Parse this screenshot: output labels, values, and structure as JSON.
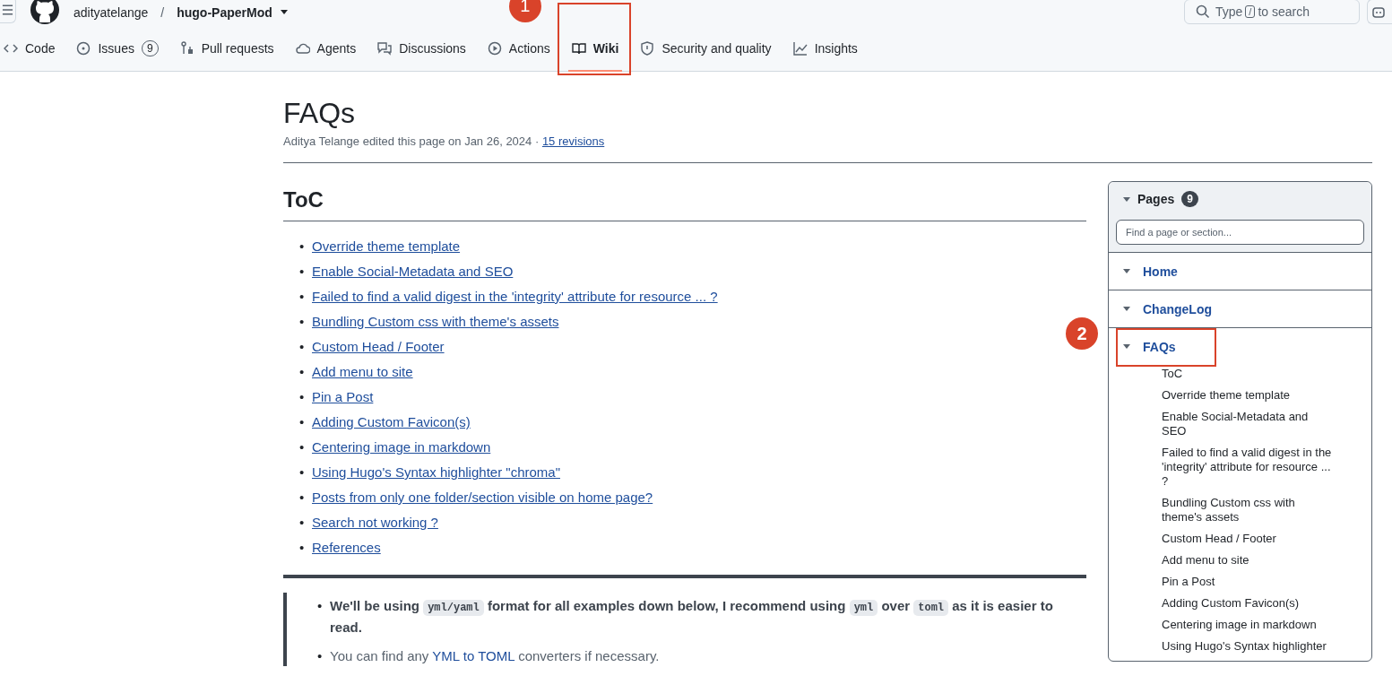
{
  "header": {
    "owner": "adityatelange",
    "separator": "/",
    "repo": "hugo-PaperMod",
    "search": {
      "placeholder_before": "Type",
      "key": "/",
      "placeholder_after": "to search"
    }
  },
  "tabs": [
    {
      "label": "Code",
      "selected": false,
      "kind": "code"
    },
    {
      "label": "Issues",
      "count": "9",
      "selected": false,
      "kind": "issues"
    },
    {
      "label": "Pull requests",
      "selected": false,
      "kind": "pulls"
    },
    {
      "label": "Agents",
      "selected": false,
      "kind": "agents"
    },
    {
      "label": "Discussions",
      "selected": false,
      "kind": "discussions"
    },
    {
      "label": "Actions",
      "selected": false,
      "kind": "actions"
    },
    {
      "label": "Wiki",
      "selected": true,
      "kind": "wiki",
      "annotation": "1"
    },
    {
      "label": "Security and quality",
      "selected": false,
      "kind": "security"
    },
    {
      "label": "Insights",
      "selected": false,
      "kind": "insights"
    }
  ],
  "page": {
    "title": "FAQs",
    "meta": "Aditya Telange edited this page on Jan 26, 2024 ·",
    "revisions": "15 revisions"
  },
  "toc": {
    "heading": "ToC",
    "bullet": "•",
    "items": [
      "Override theme template",
      "Enable Social-Metadata and SEO",
      "Failed to find a valid digest in the 'integrity' attribute for resource ... ?",
      "Bundling Custom css with theme's assets",
      "Custom Head / Footer",
      "Add menu to site",
      "Pin a Post",
      "Adding Custom Favicon(s)",
      "Centering image in markdown",
      "Using Hugo's Syntax highlighter \"chroma\"",
      "Posts from only one folder/section visible on home page?",
      "Search not working ?",
      "References"
    ]
  },
  "note_bullet": "•",
  "note": [
    {
      "bold": true,
      "segments": [
        {
          "kind": "text",
          "text": "We'll be using"
        },
        {
          "kind": "code",
          "text": "yml/yaml"
        },
        {
          "kind": "text",
          "text": "format for all examples down below, I recommend using"
        },
        {
          "kind": "code",
          "text": "yml"
        },
        {
          "kind": "text",
          "text": "over"
        },
        {
          "kind": "code",
          "text": "toml"
        },
        {
          "kind": "text",
          "text": "as it is easier to read."
        }
      ]
    },
    {
      "bold": false,
      "segments": [
        {
          "kind": "text",
          "text": "You can find any"
        },
        {
          "kind": "link",
          "text": "YML to TOML"
        },
        {
          "kind": "text",
          "text": "converters if necessary."
        }
      ]
    }
  ],
  "sidebar": {
    "title": "Pages",
    "count": "9",
    "search_placeholder": "Find a page or section...",
    "pages": [
      {
        "label": "Home",
        "expanded": true
      },
      {
        "label": "ChangeLog",
        "expanded": true
      },
      {
        "label": "FAQs",
        "expanded": true,
        "annotation": "2",
        "children": [
          "ToC",
          "Override theme template",
          "Enable Social-Metadata and SEO",
          "Failed to find a valid digest in the 'integrity' attribute for resource ... ?",
          "Bundling Custom css with theme's assets",
          "Custom Head / Footer",
          "Add menu to site",
          "Pin a Post",
          "Adding Custom Favicon(s)",
          "Centering image in markdown",
          "Using Hugo's Syntax highlighter"
        ]
      }
    ]
  }
}
